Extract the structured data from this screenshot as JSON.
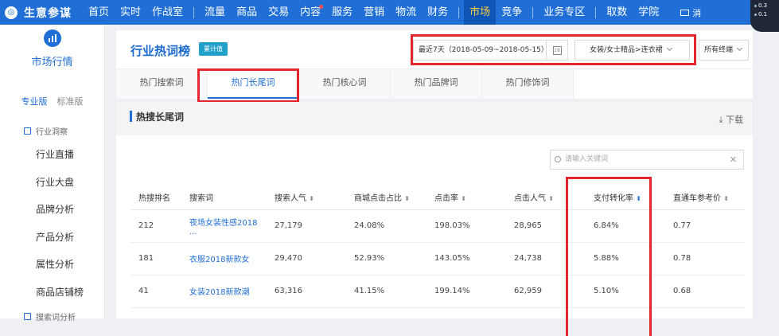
{
  "topnav": {
    "logo_mark": "◎",
    "brand": "生意参谋",
    "group1": [
      "首页",
      "实时",
      "作战室"
    ],
    "group2": [
      "流量",
      "商品",
      "交易",
      "内容",
      "服务",
      "营销",
      "物流",
      "财务"
    ],
    "active": "市场",
    "after_active": "竞争",
    "group3": [
      "业务专区"
    ],
    "group4": [
      "取数",
      "学院"
    ],
    "mail": "消",
    "speed_up": "0.3",
    "speed_down": "0.1"
  },
  "sidebar": {
    "title": "市场行情",
    "tabs": [
      "专业版",
      "标准版"
    ],
    "section": "行业洞察",
    "items": [
      "行业直播",
      "行业大盘",
      "品牌分析",
      "产品分析",
      "属性分析",
      "商品店铺榜"
    ],
    "next_section": "搜索词分析"
  },
  "header": {
    "title": "行业热词榜",
    "badge": "累计值",
    "date_range": "最近7天（2018-05-09~2018-05-15）",
    "calendar_label": "18",
    "category": "女装/女士精品>连衣裙",
    "channel": "所有终端"
  },
  "tabs": [
    "热门搜索词",
    "热门长尾词",
    "热门核心词",
    "热门品牌词",
    "热门修饰词"
  ],
  "active_tab_index": 1,
  "section": {
    "title": "热搜长尾词",
    "download": "下载",
    "search_placeholder": "请输入关键词"
  },
  "table": {
    "columns": [
      "热搜排名",
      "搜索词",
      "搜索人气",
      "商城点击占比",
      "点击率",
      "点击人气",
      "支付转化率",
      "直通车参考价"
    ],
    "rows": [
      [
        "212",
        "夜场女装性感2018 ...",
        "27,179",
        "24.08%",
        "198.03%",
        "28,965",
        "6.84%",
        "0.77"
      ],
      [
        "181",
        "衣服2018新款女",
        "29,470",
        "52.93%",
        "143.05%",
        "24,738",
        "5.88%",
        "0.78"
      ],
      [
        "41",
        "女装2018新款潮",
        "63,316",
        "41.15%",
        "199.14%",
        "62,959",
        "5.10%",
        "0.68"
      ]
    ]
  }
}
